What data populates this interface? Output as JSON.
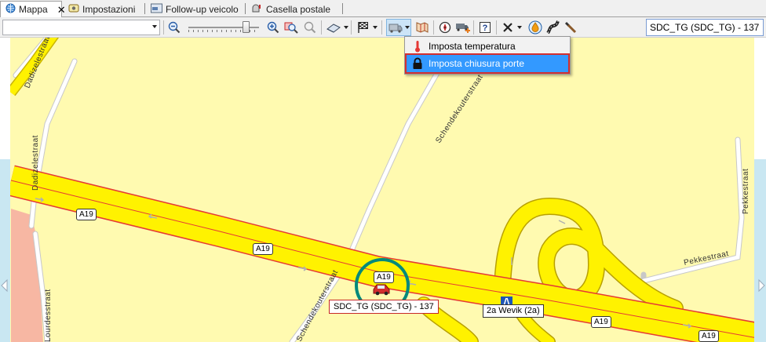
{
  "tabs": [
    {
      "label": "Mappa",
      "icon": "globe-icon",
      "active": true
    },
    {
      "label": "Impostazioni",
      "icon": "settings-icon",
      "active": false
    },
    {
      "label": "Follow-up veicolo",
      "icon": "truck-window-icon",
      "active": false
    },
    {
      "label": "Casella postale",
      "icon": "mailbox-icon",
      "active": false
    }
  ],
  "toolbar": {
    "combo_value": "",
    "search_value": "SDC_TG (SDC_TG) - 137"
  },
  "dropdown_menu": {
    "items": [
      {
        "label": "Imposta temperatura",
        "icon": "thermometer-icon",
        "highlighted": false
      },
      {
        "label": "Imposta chiusura porte",
        "icon": "lock-icon",
        "highlighted": true
      }
    ]
  },
  "map": {
    "street_labels": [
      "Dadizelestraat",
      "Schendekouterstraat",
      "Dadizelestraat",
      "Pekkestraat",
      "Pekkestraat",
      "Lourdesstraat",
      "Schendekouterstraat"
    ],
    "route_shields": [
      "A19",
      "A19",
      "A19",
      "A19",
      "A19"
    ],
    "poi_label": "2a Wevik (2a)",
    "vehicle_label": "SDC_TG (SDC_TG) - 137",
    "colors": {
      "land": "#fffab0",
      "road": "#fff200",
      "highway_edge": "#e53935",
      "vehicle_ring": "#00897b"
    }
  }
}
